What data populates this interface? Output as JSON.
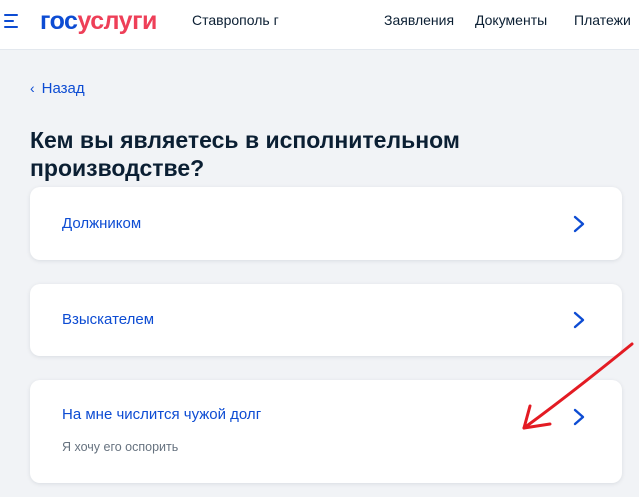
{
  "header": {
    "logo_part1": "гос",
    "logo_part2": "услуги",
    "city": "Ставрополь г",
    "nav": [
      "Заявления",
      "Документы",
      "Платежи"
    ]
  },
  "back_label": "Назад",
  "title": "Кем вы являетесь в исполнительном производстве?",
  "options": [
    {
      "label": "Должником"
    },
    {
      "label": "Взыскателем"
    },
    {
      "label": "На мне числится чужой долг",
      "sub": "Я хочу его оспорить"
    }
  ],
  "colors": {
    "brand_blue": "#0d4cd3",
    "brand_red": "#ee3f58",
    "annotation_red": "#e31b23"
  },
  "icons": [
    "menu-icon",
    "chevron-left-icon",
    "chevron-right-icon",
    "red-arrow-annotation-icon"
  ]
}
